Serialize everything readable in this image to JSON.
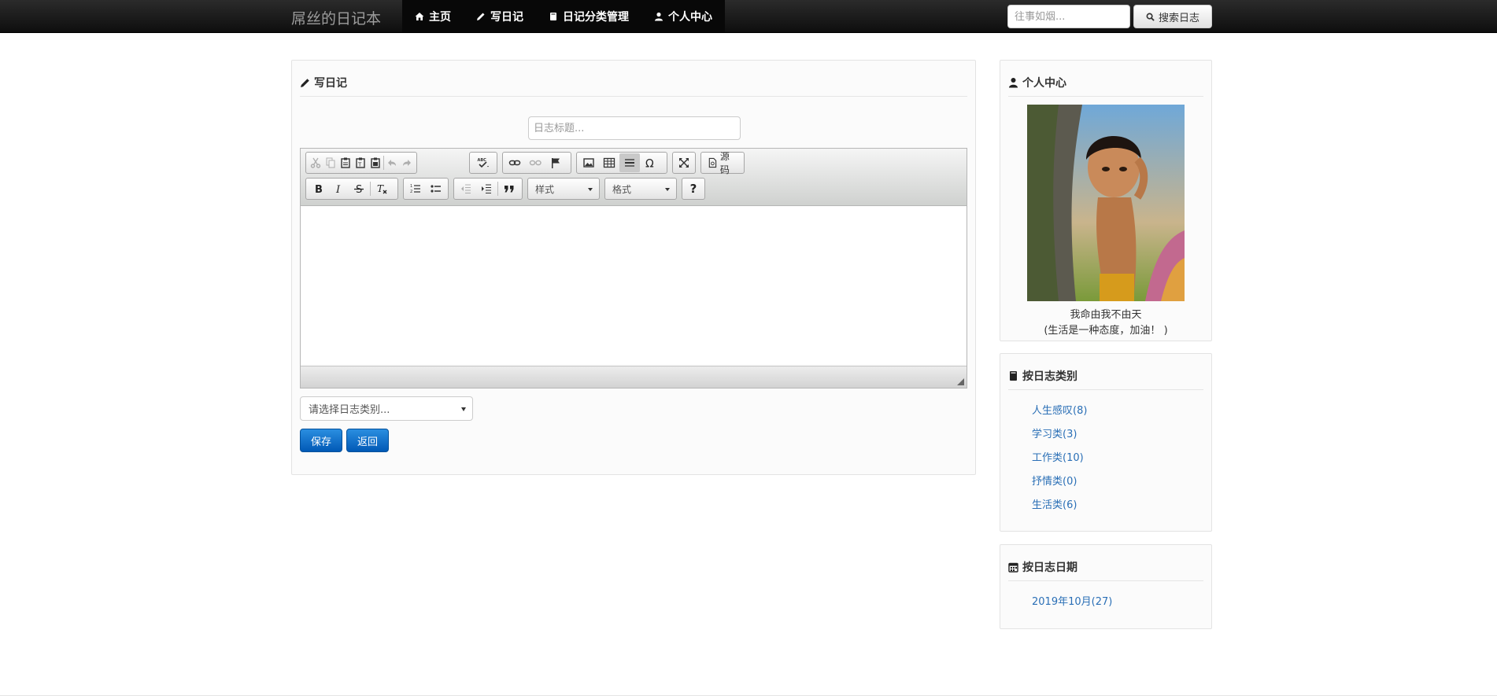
{
  "navbar": {
    "brand": "屌丝的日记本",
    "items": [
      {
        "label": "主页",
        "icon": "home-icon"
      },
      {
        "label": "写日记",
        "icon": "pencil-icon"
      },
      {
        "label": "日记分类管理",
        "icon": "book-icon"
      },
      {
        "label": "个人中心",
        "icon": "user-icon"
      }
    ],
    "search_placeholder": "往事如烟...",
    "search_button": "搜索日志"
  },
  "main": {
    "heading": "写日记",
    "title_placeholder": "日志标题...",
    "editor": {
      "source_label": "源码",
      "style_combo": "样式",
      "format_combo": "格式",
      "help_label": "?"
    },
    "category_placeholder": "请选择日志类别...",
    "save_label": "保存",
    "back_label": "返回"
  },
  "sidebar": {
    "profile": {
      "heading": "个人中心",
      "motto_line1": "我命由我不由天",
      "motto_line2": "(生活是一种态度，加油！ )"
    },
    "categories": {
      "heading": "按日志类别",
      "items": [
        "人生感叹(8)",
        "学习类(3)",
        "工作类(10)",
        "抒情类(0)",
        "生活类(6)"
      ]
    },
    "dates": {
      "heading": "按日志日期",
      "items": [
        "2019年10月(27)"
      ]
    }
  },
  "colors": {
    "navbar_bg": "#111111",
    "primary_button": "#0d6fcc",
    "link": "#2a6fb6"
  }
}
